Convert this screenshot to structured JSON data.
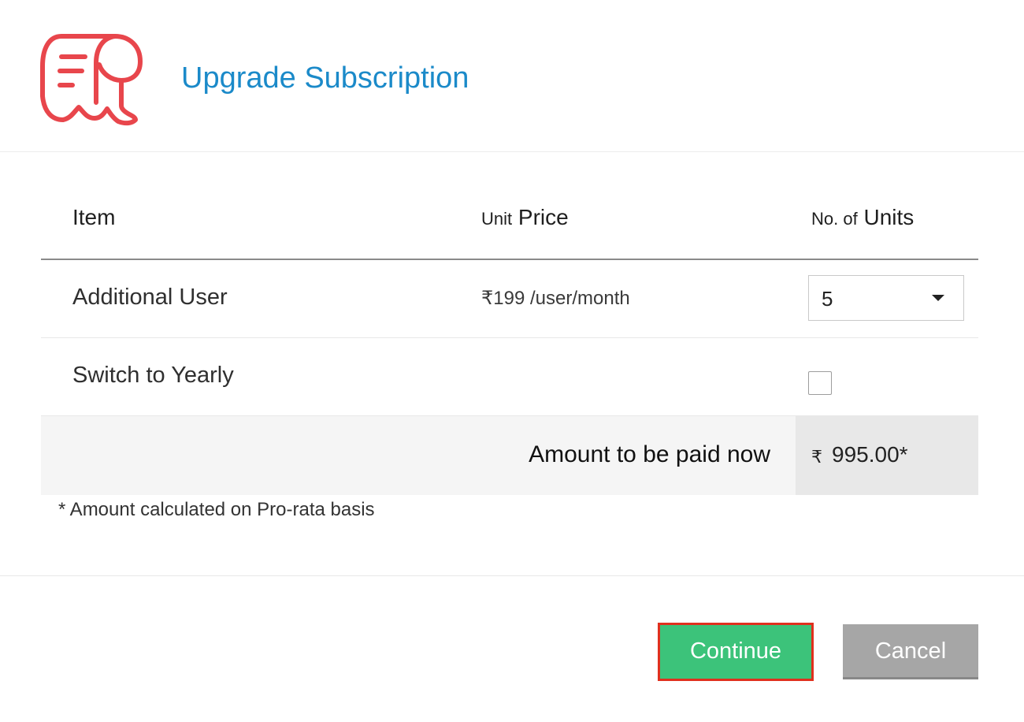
{
  "header": {
    "title": "Upgrade Subscription",
    "logo_icon": "receipt-icon",
    "logo_color": "#e8464c",
    "title_color": "#1b8ac9"
  },
  "table": {
    "columns": {
      "item": "Item",
      "unit_price_prefix": "Unit",
      "unit_price_main": "Price",
      "units_prefix": "No. of",
      "units_main": "Units"
    },
    "rows": [
      {
        "label": "Additional User",
        "price": "₹199 /user/month",
        "units_selected": "5"
      },
      {
        "label": "Switch to Yearly",
        "checked": false
      }
    ],
    "total": {
      "label": "Amount to be paid now",
      "currency": "₹",
      "amount": "995.00*"
    }
  },
  "footnote": "* Amount calculated on Pro-rata basis",
  "buttons": {
    "continue": "Continue",
    "cancel": "Cancel",
    "continue_color": "#3cc37a",
    "cancel_color": "#a6a6a6",
    "highlight_color": "#e0301e"
  }
}
